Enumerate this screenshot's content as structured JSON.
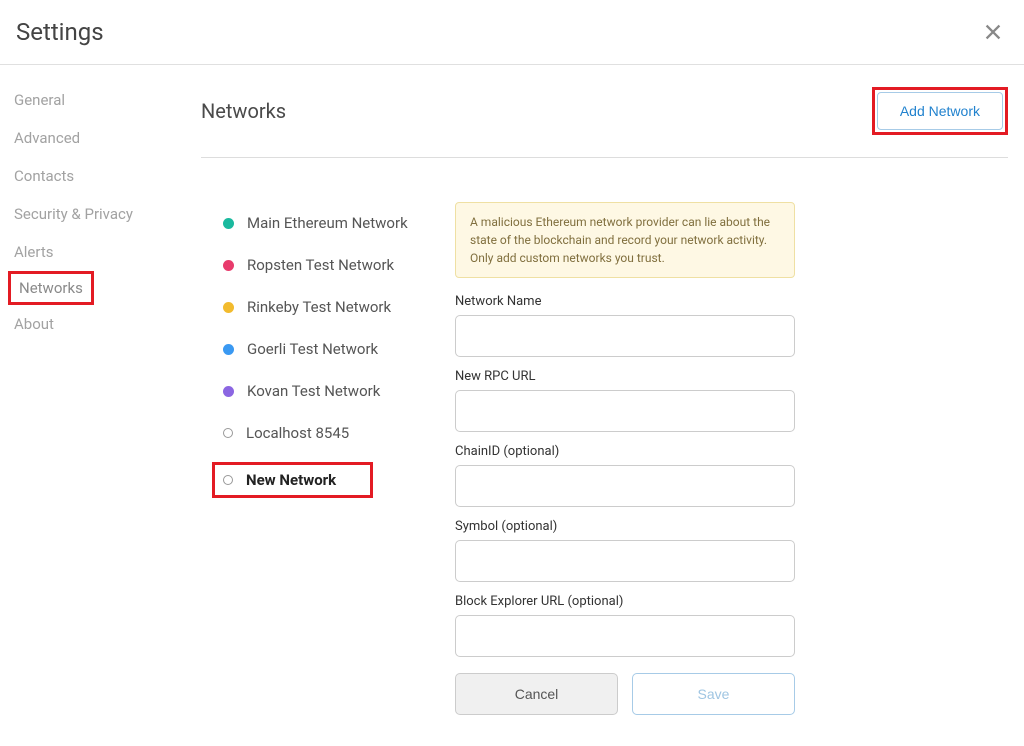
{
  "header": {
    "title": "Settings"
  },
  "sidebar": {
    "items": [
      {
        "label": "General",
        "active": false
      },
      {
        "label": "Advanced",
        "active": false
      },
      {
        "label": "Contacts",
        "active": false
      },
      {
        "label": "Security & Privacy",
        "active": false
      },
      {
        "label": "Alerts",
        "active": false
      },
      {
        "label": "Networks",
        "active": true
      },
      {
        "label": "About",
        "active": false
      }
    ]
  },
  "content": {
    "title": "Networks",
    "add_button": "Add Network",
    "networks": [
      {
        "label": "Main Ethereum Network",
        "color": "teal"
      },
      {
        "label": "Ropsten Test Network",
        "color": "pink"
      },
      {
        "label": "Rinkeby Test Network",
        "color": "yellow"
      },
      {
        "label": "Goerli Test Network",
        "color": "blue"
      },
      {
        "label": "Kovan Test Network",
        "color": "purple"
      },
      {
        "label": "Localhost 8545",
        "color": "ring"
      },
      {
        "label": "New Network",
        "color": "ring",
        "highlighted": true
      }
    ],
    "warning": "A malicious Ethereum network provider can lie about the state of the blockchain and record your network activity. Only add custom networks you trust.",
    "form": {
      "network_name_label": "Network Name",
      "rpc_url_label": "New RPC URL",
      "chain_id_label": "ChainID (optional)",
      "symbol_label": "Symbol (optional)",
      "explorer_label": "Block Explorer URL (optional)",
      "cancel": "Cancel",
      "save": "Save"
    }
  }
}
